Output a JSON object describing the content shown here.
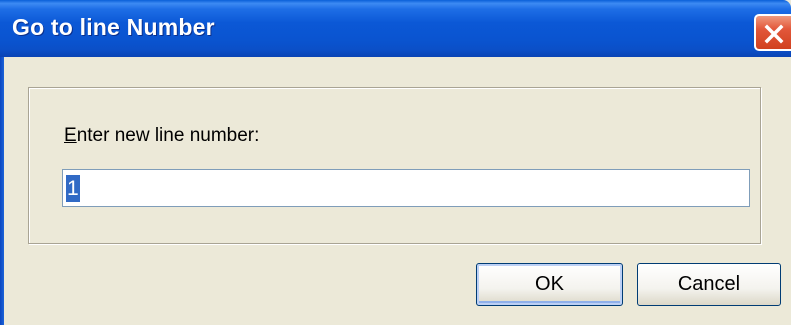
{
  "dialog": {
    "title": "Go to line Number",
    "prompt_accel": "E",
    "prompt_rest": "nter new line number:",
    "line_value": "1",
    "ok_label": "OK",
    "cancel_label": "Cancel"
  },
  "icons": {
    "close": "close-icon"
  },
  "colors": {
    "titlebar": "#0b58d6",
    "face": "#ece9d8",
    "close": "#e2573a",
    "selection": "#316ac5",
    "input_border": "#7f9db9",
    "button_border": "#003c74"
  }
}
